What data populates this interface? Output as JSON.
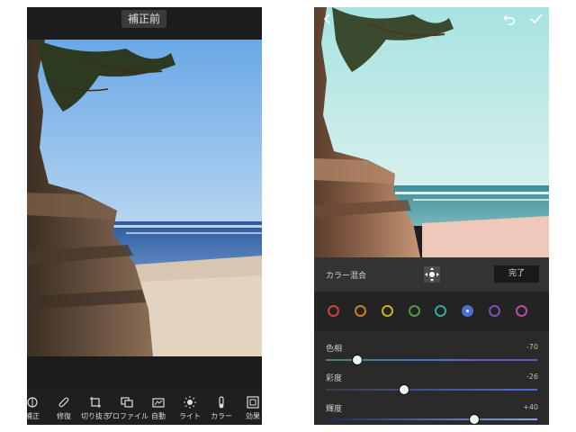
{
  "left_screen": {
    "before_badge": "補正前",
    "toolbar": [
      {
        "icon": "adjust-icon",
        "label": "補正"
      },
      {
        "icon": "heal-icon",
        "label": "修復"
      },
      {
        "icon": "crop-icon",
        "label": "切り抜き"
      },
      {
        "icon": "profile-icon",
        "label": "プロファイル"
      },
      {
        "icon": "auto-icon",
        "label": "自動"
      },
      {
        "icon": "light-icon",
        "label": "ライト"
      },
      {
        "icon": "color-icon",
        "label": "カラー"
      },
      {
        "icon": "effects-icon",
        "label": "効果"
      }
    ]
  },
  "right_screen": {
    "panel_title": "カラー混合",
    "done_label": "完了",
    "swatches": [
      {
        "name": "red",
        "color": "#c9423c"
      },
      {
        "name": "orange",
        "color": "#c97a2a"
      },
      {
        "name": "yellow",
        "color": "#c9b02a"
      },
      {
        "name": "green",
        "color": "#4f9a45"
      },
      {
        "name": "aqua",
        "color": "#3aa6a6"
      },
      {
        "name": "blue",
        "color": "#4a6fd8",
        "selected": true
      },
      {
        "name": "purple",
        "color": "#7d4fb5"
      },
      {
        "name": "magenta",
        "color": "#b54fa6"
      }
    ],
    "sliders": [
      {
        "label": "色相",
        "value": "-70",
        "level": -70
      },
      {
        "label": "彩度",
        "value": "-26",
        "level": -26
      },
      {
        "label": "輝度",
        "value": "+40",
        "level": 40
      }
    ]
  }
}
